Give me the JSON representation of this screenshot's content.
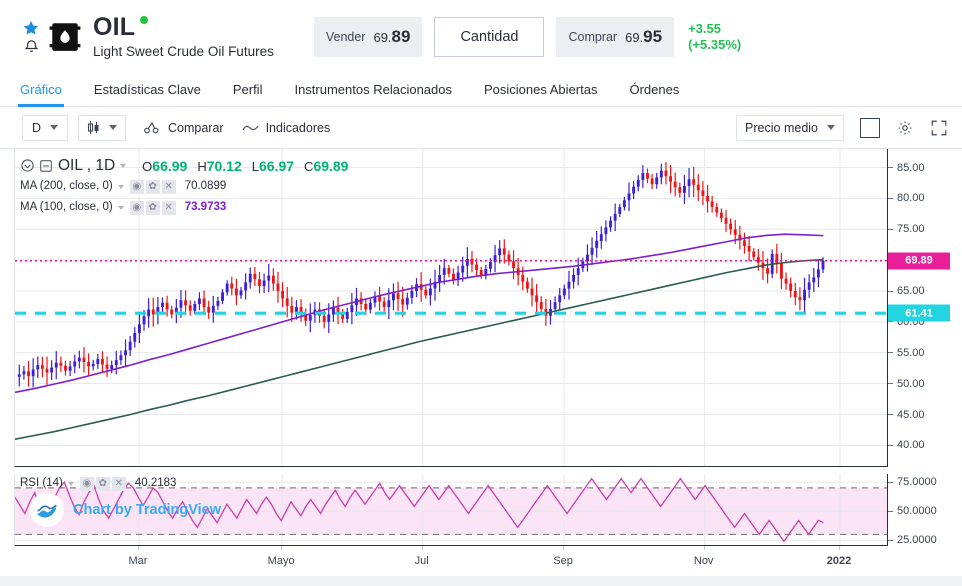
{
  "header": {
    "star_icon": "star-icon",
    "bell_icon": "bell-icon",
    "instrument_icon": "oil-barrel-icon",
    "symbol": "OIL",
    "description": "Light Sweet Crude Oil Futures",
    "live_status_color": "#21c535",
    "sell": {
      "label": "Vender",
      "int": "69.",
      "dec": "89"
    },
    "quantity_button": "Cantidad",
    "buy": {
      "label": "Comprar",
      "int": "69.",
      "dec": "95"
    },
    "change_abs": "+3.55",
    "change_pct": "(+5.35%)",
    "change_color": "#24c054"
  },
  "nav": {
    "tabs": [
      {
        "label": "Gráfico",
        "active": true
      },
      {
        "label": "Estadísticas Clave",
        "active": false
      },
      {
        "label": "Perfil",
        "active": false
      },
      {
        "label": "Instrumentos Relacionados",
        "active": false
      },
      {
        "label": "Posiciones Abiertas",
        "active": false
      },
      {
        "label": "Órdenes",
        "active": false
      }
    ],
    "accent": "#2196f3"
  },
  "toolbar": {
    "interval": "D",
    "chart_type_icon": "candlestick-icon",
    "compare_icon": "compare-icon",
    "compare": "Comparar",
    "indicators_icon": "indicators-wave-icon",
    "indicators": "Indicadores",
    "price_mode": "Precio medio",
    "fullscreen_icon": "fullscreen-icon",
    "settings_icon": "gear-icon",
    "square_icon": "square-toggle-icon"
  },
  "legend": {
    "symbol_title": "OIL , 1D",
    "eye_icon": "eye-icon",
    "minus_icon": "collapse-icon",
    "ohlc": [
      {
        "key": "O",
        "value": "66.99"
      },
      {
        "key": "H",
        "value": "70.12"
      },
      {
        "key": "L",
        "value": "66.97"
      },
      {
        "key": "C",
        "value": "69.89"
      }
    ],
    "ohlc_color": "#00b275",
    "studies": [
      {
        "name": "MA (200, close, 0)",
        "value": "70.0899",
        "color": "#2a5c52"
      },
      {
        "name": "MA (100, close, 0)",
        "value": "73.9733",
        "color": "#7b1fd1"
      }
    ],
    "study_icons": [
      "visibility-icon",
      "settings-icon",
      "remove-icon"
    ]
  },
  "rsi_legend": {
    "name": "RSI (14)",
    "value": "40.2183",
    "color": "#cc3eab"
  },
  "branding": {
    "logo_icon": "tradingview-logo-icon",
    "text": "Chart by TradingView"
  },
  "chart_data": {
    "type": "line",
    "title": "OIL , 1D",
    "xlabel": "",
    "ylabel": "",
    "ylim": [
      36.5,
      88.0
    ],
    "grid": true,
    "legend_position": "top-left",
    "time_ticks": [
      {
        "label": "Mar",
        "x_pct": 14.2
      },
      {
        "label": "Mayo",
        "x_pct": 30.6
      },
      {
        "label": "Jul",
        "x_pct": 46.7
      },
      {
        "label": "Sep",
        "x_pct": 62.9
      },
      {
        "label": "Nov",
        "x_pct": 79.0
      },
      {
        "label": "2022",
        "x_pct": 94.5,
        "bold": true
      }
    ],
    "price_ticks": [
      85.0,
      80.0,
      75.0,
      70.0,
      65.0,
      60.0,
      55.0,
      50.0,
      45.0,
      40.0
    ],
    "price_tick_labels": [
      "85.00",
      "80.00",
      "75.00",
      "70.00",
      "65.00",
      "60.00",
      "55.00",
      "50.00",
      "45.00",
      "40.00"
    ],
    "markers": [
      {
        "name": "last-price-line",
        "value": 69.89,
        "label": "69.89",
        "color": "#e91e99",
        "style": "dotted"
      },
      {
        "name": "alert-line",
        "value": 61.41,
        "label": "61.41",
        "color": "#22d3e0",
        "style": "dashed"
      }
    ],
    "series": [
      {
        "name": "MA 100",
        "color": "#7b1fd1",
        "values": [
          48.6,
          49.2,
          49.9,
          50.6,
          51.4,
          52.2,
          53.0,
          53.9,
          54.7,
          55.6,
          56.5,
          57.4,
          58.3,
          59.2,
          60.1,
          61.0,
          61.9,
          62.7,
          63.5,
          64.3,
          65.0,
          65.7,
          66.4,
          66.9,
          67.4,
          67.8,
          68.1,
          68.4,
          68.7,
          69.0,
          69.4,
          69.8,
          70.2,
          70.7,
          71.2,
          71.8,
          72.4,
          73.0,
          73.6,
          74.0,
          74.2,
          74.1,
          73.97
        ]
      },
      {
        "name": "MA 200",
        "color": "#2a5c52",
        "values": [
          41.0,
          41.6,
          42.2,
          42.9,
          43.6,
          44.3,
          45.0,
          45.8,
          46.5,
          47.3,
          48.0,
          48.8,
          49.6,
          50.4,
          51.2,
          52.0,
          52.8,
          53.6,
          54.4,
          55.2,
          56.0,
          56.8,
          57.5,
          58.2,
          58.9,
          59.6,
          60.3,
          61.0,
          61.7,
          62.4,
          63.1,
          63.8,
          64.5,
          65.2,
          65.9,
          66.6,
          67.3,
          68.0,
          68.6,
          69.2,
          69.6,
          69.9,
          70.09
        ]
      },
      {
        "name": "OIL close",
        "color": "#3b20d6",
        "values": [
          51.5,
          52.0,
          51.2,
          52.3,
          53.0,
          52.4,
          51.8,
          52.6,
          53.4,
          52.9,
          52.1,
          52.8,
          53.6,
          54.2,
          53.5,
          52.8,
          53.2,
          54.0,
          53.1,
          52.4,
          53.0,
          53.8,
          54.6,
          55.4,
          56.8,
          58.2,
          59.6,
          60.9,
          62.0,
          61.2,
          62.4,
          63.1,
          62.0,
          61.2,
          62.3,
          63.5,
          62.7,
          61.8,
          62.9,
          63.8,
          62.4,
          61.5,
          62.6,
          63.4,
          64.8,
          66.2,
          65.4,
          64.3,
          65.1,
          66.4,
          67.8,
          66.9,
          65.8,
          66.7,
          67.5,
          66.2,
          65.0,
          63.8,
          62.6,
          61.5,
          62.4,
          61.3,
          60.2,
          61.1,
          62.0,
          61.0,
          60.0,
          61.2,
          62.3,
          61.4,
          60.5,
          61.6,
          62.7,
          63.8,
          62.9,
          62.0,
          63.1,
          64.2,
          63.3,
          62.4,
          63.5,
          64.6,
          63.7,
          62.8,
          63.9,
          65.0,
          66.1,
          65.2,
          64.3,
          65.4,
          66.5,
          67.6,
          68.7,
          67.8,
          66.9,
          68.0,
          69.1,
          70.2,
          69.3,
          68.4,
          67.5,
          68.6,
          69.7,
          70.8,
          71.9,
          70.9,
          69.8,
          68.7,
          67.6,
          66.5,
          65.4,
          64.3,
          63.2,
          62.1,
          61.0,
          62.1,
          63.2,
          64.3,
          65.4,
          66.5,
          67.6,
          68.7,
          69.8,
          70.9,
          72.0,
          73.1,
          74.2,
          75.3,
          76.4,
          77.5,
          78.6,
          79.7,
          80.8,
          81.9,
          83.0,
          84.1,
          83.2,
          82.3,
          83.4,
          84.5,
          83.6,
          82.7,
          81.8,
          80.9,
          82.0,
          83.1,
          82.2,
          81.3,
          80.4,
          79.5,
          78.6,
          77.7,
          76.8,
          75.9,
          75.0,
          74.1,
          73.2,
          72.3,
          71.4,
          70.5,
          69.6,
          68.7,
          67.8,
          71.0,
          69.5,
          67.0,
          66.2,
          65.0,
          64.0,
          63.5,
          65.2,
          66.4,
          67.2,
          68.5,
          69.89
        ]
      }
    ],
    "rsi": {
      "name": "RSI (14)",
      "period": 14,
      "value": 40.2183,
      "color": "#cc3eab",
      "ylim": [
        20,
        82
      ],
      "ticks": [
        75.0,
        50.0,
        25.0
      ],
      "tick_labels": [
        "75.0000",
        "50.0000",
        "25.0000"
      ],
      "band": [
        30,
        70
      ],
      "band_fill": "#fbe4f5",
      "values": [
        62,
        55,
        48,
        58,
        66,
        52,
        44,
        50,
        61,
        70,
        75,
        64,
        54,
        47,
        58,
        66,
        72,
        60,
        50,
        44,
        52,
        60,
        68,
        74,
        70,
        62,
        55,
        62,
        70,
        66,
        58,
        50,
        44,
        52,
        58,
        50,
        42,
        36,
        44,
        52,
        46,
        40,
        48,
        56,
        50,
        44,
        52,
        60,
        54,
        48,
        56,
        62,
        56,
        48,
        42,
        50,
        58,
        52,
        46,
        54,
        60,
        54,
        48,
        56,
        62,
        68,
        60,
        54,
        62,
        68,
        62,
        56,
        62,
        68,
        74,
        66,
        60,
        66,
        72,
        66,
        60,
        54,
        60,
        66,
        72,
        66,
        60,
        66,
        72,
        66,
        60,
        54,
        48,
        54,
        60,
        66,
        72,
        66,
        60,
        54,
        48,
        42,
        36,
        42,
        48,
        54,
        60,
        66,
        72,
        66,
        60,
        54,
        48,
        54,
        60,
        66,
        72,
        78,
        72,
        66,
        60,
        66,
        72,
        78,
        72,
        66,
        72,
        78,
        72,
        66,
        60,
        54,
        60,
        66,
        72,
        78,
        72,
        66,
        60,
        66,
        72,
        66,
        60,
        54,
        48,
        42,
        36,
        42,
        48,
        42,
        36,
        30,
        36,
        42,
        36,
        30,
        24,
        30,
        36,
        42,
        36,
        30,
        36,
        42,
        40.2
      ]
    }
  }
}
